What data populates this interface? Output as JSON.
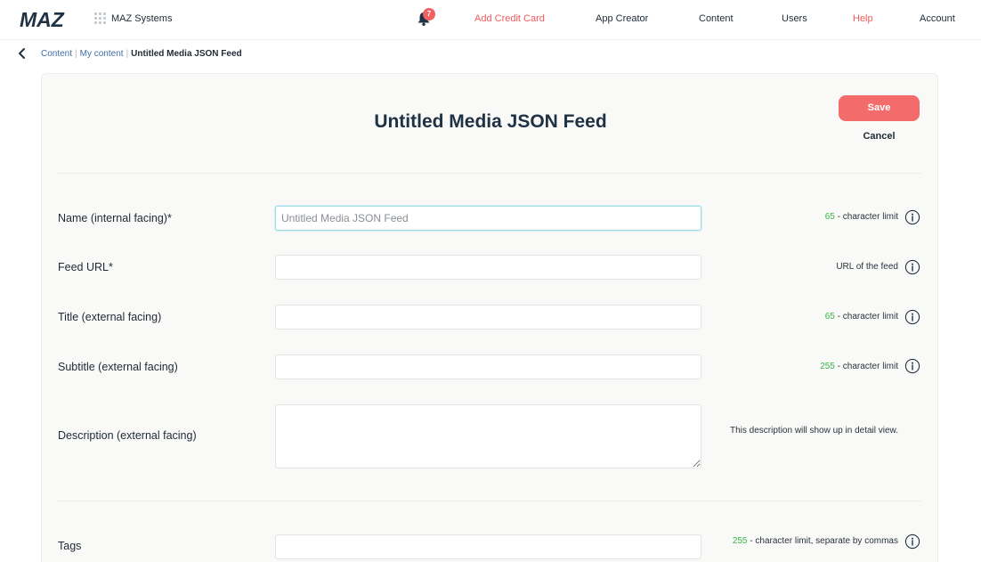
{
  "brand": {
    "logo_text": "MAZ",
    "org_name": "MAZ Systems"
  },
  "nav": {
    "notification_count": "7",
    "items": [
      {
        "label": "Add Credit Card",
        "accent": true
      },
      {
        "label": "App Creator",
        "accent": false
      },
      {
        "label": "Content",
        "accent": false
      },
      {
        "label": "Users",
        "accent": false
      },
      {
        "label": "Help",
        "accent": true
      },
      {
        "label": "Account",
        "accent": false
      }
    ]
  },
  "breadcrumb": {
    "items": [
      "Content",
      "My content"
    ],
    "current": "Untitled Media JSON Feed",
    "separator": "|"
  },
  "page": {
    "title": "Untitled Media JSON Feed",
    "save_label": "Save",
    "cancel_label": "Cancel"
  },
  "form": {
    "name": {
      "label": "Name (internal facing)*",
      "placeholder": "Untitled Media JSON Feed",
      "value": "",
      "limit": "65",
      "hint": " - character limit"
    },
    "feed_url": {
      "label": "Feed URL*",
      "placeholder": "",
      "value": "",
      "hint": "URL of the feed"
    },
    "title": {
      "label": "Title (external facing)",
      "placeholder": "",
      "value": "",
      "limit": "65",
      "hint": " - character limit"
    },
    "subtitle": {
      "label": "Subtitle (external facing)",
      "placeholder": "",
      "value": "",
      "limit": "255",
      "hint": " - character limit"
    },
    "description": {
      "label": "Description (external facing)",
      "placeholder": "",
      "value": "",
      "hint": "This description will show up in detail view."
    },
    "tags": {
      "label": "Tags",
      "placeholder": "",
      "value": "",
      "limit": "255",
      "hint": " - character limit, separate by commas"
    }
  },
  "colors": {
    "accent": "#f46b6b",
    "limit_green": "#39b54a",
    "title": "#1f3244",
    "link": "#3d6ea8"
  },
  "icons": [
    "maz-logo",
    "grid-icon",
    "bell-icon",
    "back-chevron-icon",
    "info-icon"
  ]
}
